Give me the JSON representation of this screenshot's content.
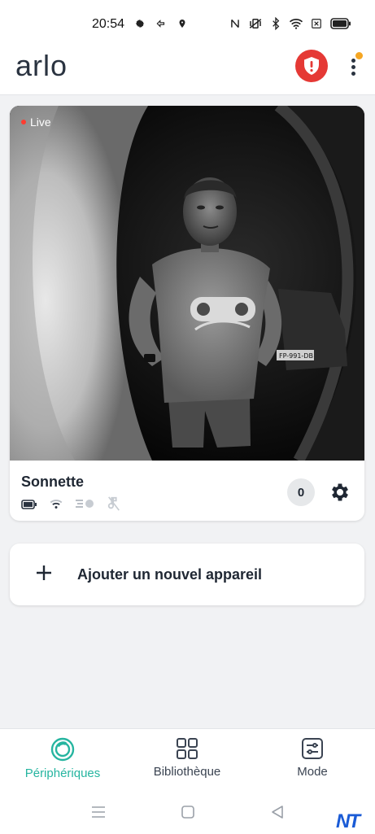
{
  "status_bar": {
    "time": "20:54"
  },
  "header": {
    "logo": "arlo"
  },
  "camera": {
    "live_label": "Live",
    "name": "Sonnette",
    "count": "0",
    "plate_text": "FP-991-DB"
  },
  "add_device": {
    "label": "Ajouter un nouvel appareil"
  },
  "nav": {
    "items": [
      {
        "label": "Périphériques",
        "icon": "devices-icon",
        "active": true
      },
      {
        "label": "Bibliothèque",
        "icon": "library-grid-icon",
        "active": false
      },
      {
        "label": "Mode",
        "icon": "mode-sliders-icon",
        "active": false
      }
    ]
  },
  "watermark": "NT",
  "colors": {
    "accent": "#26b5a0",
    "alert": "#e53935",
    "notification": "#f5a623"
  }
}
